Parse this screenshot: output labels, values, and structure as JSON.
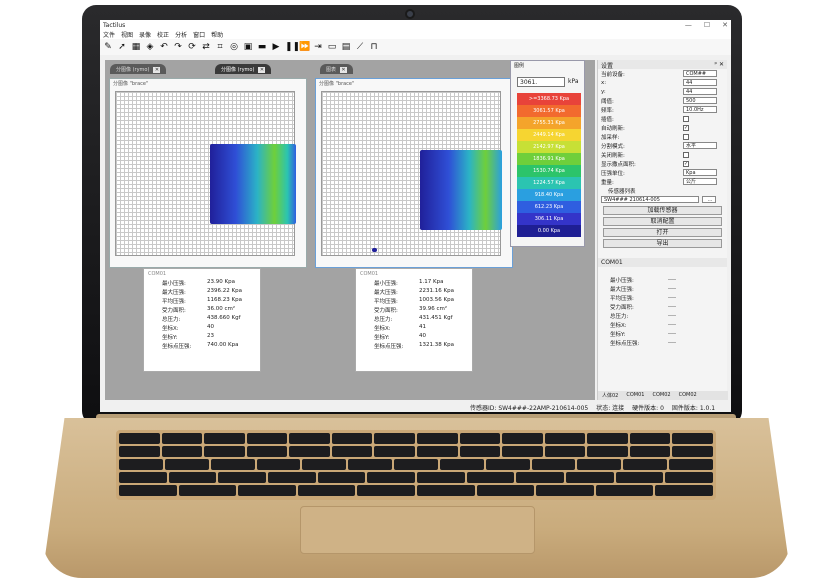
{
  "app": {
    "title": "Tactilus"
  },
  "menu": [
    "文件",
    "视图",
    "录像",
    "校正",
    "分析",
    "窗口",
    "帮助"
  ],
  "toolbar_icons": [
    "pen-icon",
    "arrow-icon",
    "grid-icon",
    "layers-icon",
    "undo-icon",
    "redo-icon",
    "rotate-icon",
    "flip-icon",
    "crop-icon",
    "target-icon",
    "camera-icon",
    "video-icon",
    "play-icon",
    "pause-icon",
    "fast-forward-icon",
    "export-icon",
    "folder-icon",
    "save-icon",
    "measure-icon",
    "lock-icon"
  ],
  "tabs": [
    {
      "label": "分图像 (rymo)"
    },
    {
      "label": "分图像 (rymo)"
    },
    {
      "label": "图表"
    }
  ],
  "panels": {
    "left_title": "分图像 \"brace\"",
    "right_title": "分图像 \"brace\""
  },
  "scale": {
    "title": "图例",
    "value": "3061.",
    "unit": "kPa",
    "bands": [
      {
        "label": ">=3368.73 Kpa",
        "color": "#e8433a"
      },
      {
        "label": "3061.57 Kpa",
        "color": "#f26a2e"
      },
      {
        "label": "2755.31 Kpa",
        "color": "#f4a42b"
      },
      {
        "label": "2449.14 Kpa",
        "color": "#f6d531"
      },
      {
        "label": "2142.97 Kpa",
        "color": "#c7e036"
      },
      {
        "label": "1836.91 Kpa",
        "color": "#6fcf3b"
      },
      {
        "label": "1530.74 Kpa",
        "color": "#2cc46a"
      },
      {
        "label": "1224.57 Kpa",
        "color": "#2bc4b1"
      },
      {
        "label": "918.40 Kpa",
        "color": "#2a9fe0"
      },
      {
        "label": "612.23 Kpa",
        "color": "#2f5ee0"
      },
      {
        "label": "306.11 Kpa",
        "color": "#3434c9"
      },
      {
        "label": "0.00 Kpa",
        "color": "#1f1f94"
      }
    ]
  },
  "stats": [
    {
      "header": "COM01",
      "rows": [
        {
          "k": "最小压强:",
          "v": "23.90 Kpa"
        },
        {
          "k": "最大压强:",
          "v": "2396.22 Kpa"
        },
        {
          "k": "平均压强:",
          "v": "1168.23 Kpa"
        },
        {
          "k": "受力面积:",
          "v": "36.00 cm²"
        },
        {
          "k": "总压力:",
          "v": "438.660 Kgf"
        },
        {
          "k": "坐标X:",
          "v": "40"
        },
        {
          "k": "坐标Y:",
          "v": "23"
        },
        {
          "k": "坐标点压强:",
          "v": "740.00 Kpa"
        }
      ]
    },
    {
      "header": "COM01",
      "rows": [
        {
          "k": "最小压强:",
          "v": "1.17 Kpa"
        },
        {
          "k": "最大压强:",
          "v": "2231.16 Kpa"
        },
        {
          "k": "平均压强:",
          "v": "1003.56 Kpa"
        },
        {
          "k": "受力面积:",
          "v": "39.96 cm²"
        },
        {
          "k": "总压力:",
          "v": "431.451 Kgf"
        },
        {
          "k": "坐标X:",
          "v": "41"
        },
        {
          "k": "坐标Y:",
          "v": "40"
        },
        {
          "k": "坐标点压强:",
          "v": "1321.38 Kpa"
        }
      ]
    }
  ],
  "settings": {
    "title": "设置",
    "rows": [
      {
        "k": "当前设备:",
        "v": "COM##",
        "type": "select"
      },
      {
        "k": "x:",
        "v": "44",
        "type": "select"
      },
      {
        "k": "y:",
        "v": "44",
        "type": "select"
      },
      {
        "k": "阈值:",
        "v": "500",
        "type": "input"
      },
      {
        "k": "频率:",
        "v": "10.0Hz",
        "type": "select"
      },
      {
        "k": "插值:",
        "v": "",
        "type": "check"
      },
      {
        "k": "自动刷新:",
        "v": "✓",
        "type": "check"
      },
      {
        "k": "加采样:",
        "v": "",
        "type": "check"
      },
      {
        "k": "分割模式:",
        "v": "水平",
        "type": "select"
      },
      {
        "k": "关闭刷新:",
        "v": "",
        "type": "check"
      },
      {
        "k": "显示撒点面积:",
        "v": "✓",
        "type": "check"
      },
      {
        "k": "压强单位:",
        "v": "Kpa",
        "type": "select"
      },
      {
        "k": "重量:",
        "v": "公斤",
        "type": "select"
      }
    ],
    "sensor_label": "传感器列表",
    "sensor_value": "SW4### 210614-005",
    "buttons": [
      "加载传感器",
      "取消配置",
      "打开",
      "导出"
    ]
  },
  "realtime": {
    "title": "COM01",
    "rows": [
      {
        "k": "最小压强:",
        "v": "----"
      },
      {
        "k": "最大压强:",
        "v": "----"
      },
      {
        "k": "平均压强:",
        "v": "----"
      },
      {
        "k": "受力面积:",
        "v": "----"
      },
      {
        "k": "总压力:",
        "v": "----"
      },
      {
        "k": "坐标X:",
        "v": "----"
      },
      {
        "k": "坐标Y:",
        "v": "----"
      },
      {
        "k": "坐标点压强:",
        "v": "----"
      }
    ]
  },
  "bottom_tabs": [
    "人体02",
    "COM01",
    "COM02",
    "COM02"
  ],
  "status": {
    "sensor": "传感器ID: SW4###-22AMP-210614-005",
    "state": "状态: 连接",
    "hw": "硬件版本: 0",
    "fw": "固件版本: 1.0.1"
  }
}
